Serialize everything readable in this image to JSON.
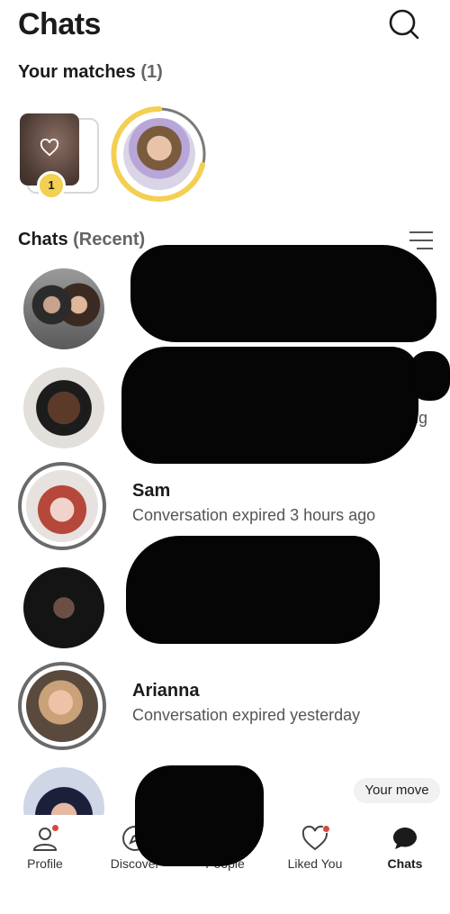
{
  "header": {
    "title": "Chats"
  },
  "matches": {
    "label": "Your matches",
    "count": "(1)",
    "badge": "1"
  },
  "chats_section": {
    "label": "Chats",
    "sublabel": "(Recent)"
  },
  "chats": [
    {
      "name": "",
      "message": ""
    },
    {
      "name": "",
      "message": "ng"
    },
    {
      "name": "Sam",
      "message": "Conversation expired 3 hours ago"
    },
    {
      "name": "",
      "message": ""
    },
    {
      "name": "Arianna",
      "message": "Conversation expired yesterday"
    },
    {
      "name": "",
      "message": "",
      "tag": "Your move"
    }
  ],
  "nav": [
    {
      "label": "Profile",
      "icon": "person-icon"
    },
    {
      "label": "Discover",
      "icon": "compass-icon"
    },
    {
      "label": "People",
      "icon": "people-icon"
    },
    {
      "label": "Liked You",
      "icon": "heart-icon"
    },
    {
      "label": "Chats",
      "icon": "chat-bubble-icon",
      "active": true
    }
  ],
  "colors": {
    "accent_yellow": "#f3cf52",
    "notification_dot": "#d64a3b"
  }
}
